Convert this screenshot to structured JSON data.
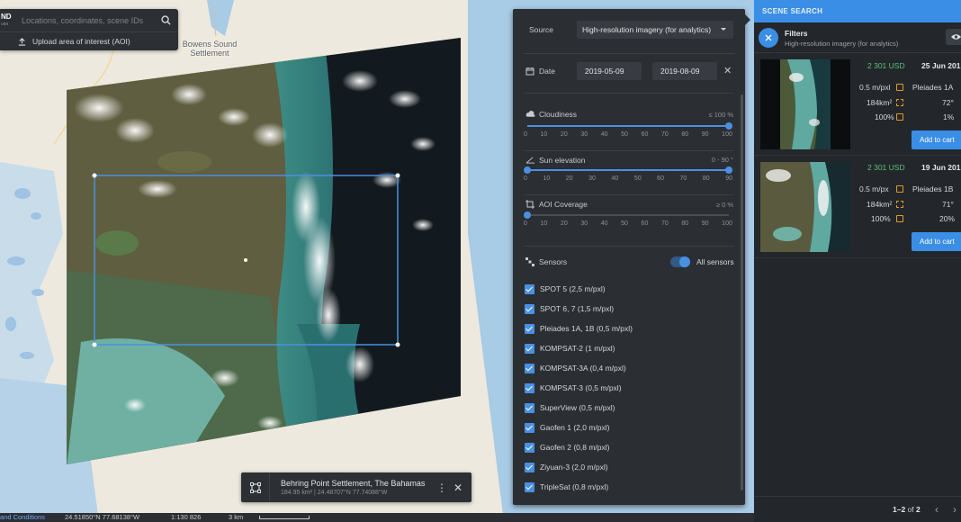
{
  "search": {
    "logo": "ND",
    "logo_sub": "VER",
    "placeholder": "Locations, coordinates, scene IDs",
    "upload_label": "Upload area of interest (AOI)"
  },
  "map": {
    "place_label": "Bowens Sound Settlement",
    "place_line1": "Bowens Sound",
    "place_line2": "Settlement"
  },
  "status_bar": {
    "terms": "and Conditions",
    "coordinates": "24.51850°N 77.68138°W",
    "scale_ratio": "1:130 826",
    "scale_distance": "3 km"
  },
  "location_card": {
    "title": "Behring Point Settlement, The Bahamas",
    "subtitle": "184.95 km² | 24.48707°N 77.74088°W"
  },
  "filters": {
    "source_label": "Source",
    "source_value": "High-resolution imagery (for analytics)",
    "date_label": "Date",
    "date_from": "2019-05-09",
    "date_to": "2019-08-09",
    "cloudiness": {
      "label": "Cloudiness",
      "value": "≤ 100 %",
      "level": 100
    },
    "sun_elevation": {
      "label": "Sun elevation",
      "value": "0 - 90 °",
      "min": 0,
      "max": 90
    },
    "aoi_coverage": {
      "label": "AOI Coverage",
      "value": "≥ 0 %",
      "level": 0
    },
    "ticks_percent": [
      "0",
      "10",
      "20",
      "30",
      "40",
      "50",
      "60",
      "70",
      "80",
      "90",
      "100"
    ],
    "ticks_degrees": [
      "0",
      "10",
      "20",
      "30",
      "40",
      "50",
      "60",
      "70",
      "80",
      "90"
    ],
    "sensors_label": "Sensors",
    "all_sensors_label": "All sensors",
    "sensors": [
      "SPOT 5 (2,5 m/pxl)",
      "SPOT 6, 7 (1,5 m/pxl)",
      "Pleiades 1A, 1B (0,5 m/pxl)",
      "KOMPSAT-2 (1 m/pxl)",
      "KOMPSAT-3A (0,4 m/pxl)",
      "KOMPSAT-3 (0,5 m/pxl)",
      "SuperView (0,5 m/pxl)",
      "Gaofen 1 (2,0 m/pxl)",
      "Gaofen 2 (0,8 m/pxl)",
      "Ziyuan-3 (2,0 m/pxl)",
      "TripleSat (0,8 m/pxl)"
    ]
  },
  "sidebar": {
    "header": "SCENE SEARCH",
    "filters_title": "Filters",
    "filters_subtitle": "High-resolution imagery (for analytics)",
    "scenes": [
      {
        "price": "2 301 USD",
        "date": "25 Jun 201",
        "resolution": "0.5 m/pxl",
        "sensor": "Pleiades 1A",
        "area": "184km²",
        "sun": "72°",
        "coverage": "100%",
        "cloud": "1%",
        "cart_label": "Add to cart"
      },
      {
        "price": "2 301 USD",
        "date": "19 Jun 201",
        "resolution": "0.5 m/px",
        "sensor": "Pleiades 1B",
        "area": "184km²",
        "sun": "71°",
        "coverage": "100%",
        "cloud": "20%",
        "cart_label": "Add to cart"
      }
    ],
    "pager_range": "1–2",
    "pager_of": "of",
    "pager_total": "2"
  },
  "colors": {
    "accent": "#4a90e2",
    "price": "#5cc27a",
    "panel_bg": "#2b2e33",
    "sidebar_bg": "#23272b"
  }
}
